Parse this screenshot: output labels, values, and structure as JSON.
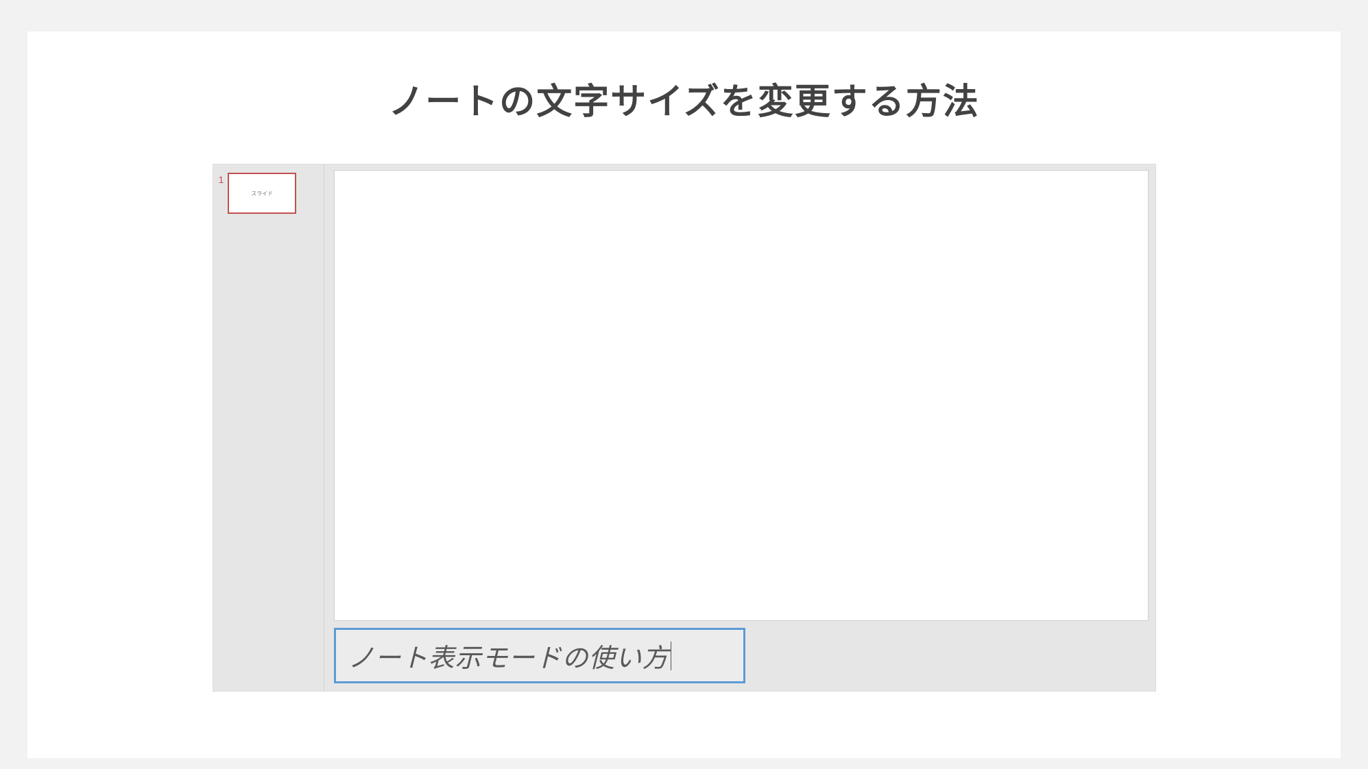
{
  "title": "ノートの文字サイズを変更する方法",
  "thumbnails": [
    {
      "index": "1",
      "label": "スライド"
    }
  ],
  "notes": {
    "text": "ノート表示モードの使い方"
  }
}
